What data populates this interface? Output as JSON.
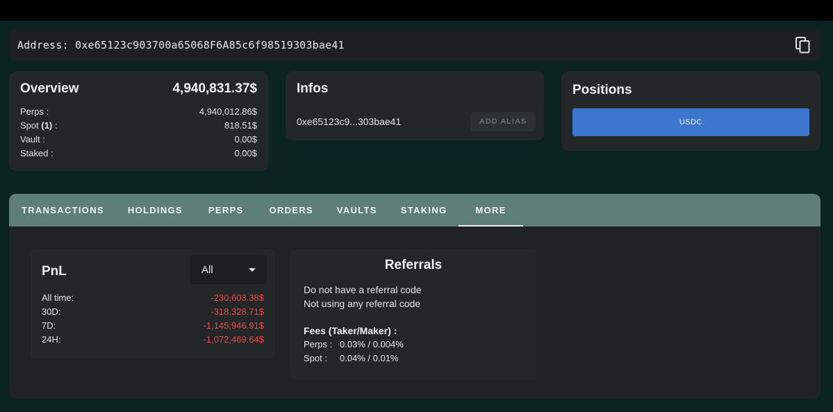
{
  "address": {
    "label": "Address:",
    "value": "0xe65123c903700a65068F6A85c6f98519303bae41",
    "copy_icon": "copy-icon"
  },
  "overview": {
    "title": "Overview",
    "total": "4,940,831.37$",
    "rows": [
      {
        "label": "Perps :",
        "value": "4,940,012.86$"
      },
      {
        "label_pre": "Spot ",
        "label_count": "(1)",
        "label_post": " :",
        "value": "818.51$"
      },
      {
        "label": "Vault :",
        "value": "0.00$"
      },
      {
        "label": "Staked :",
        "value": "0.00$"
      }
    ]
  },
  "infos": {
    "title": "Infos",
    "short_address": "0xe65123c9...303bae41",
    "alias_button": "ADD ALIAS"
  },
  "positions": {
    "title": "Positions",
    "bar_label": "USDC",
    "bar_color": "#3c76cf"
  },
  "tabs": [
    {
      "label": "TRANSACTIONS",
      "active": false
    },
    {
      "label": "HOLDINGS",
      "active": false
    },
    {
      "label": "PERPS",
      "active": false
    },
    {
      "label": "ORDERS",
      "active": false
    },
    {
      "label": "VAULTS",
      "active": false
    },
    {
      "label": "STAKING",
      "active": false
    },
    {
      "label": "MORE",
      "active": true
    }
  ],
  "pnl": {
    "title": "PnL",
    "period_select": "All",
    "rows": [
      {
        "label": "All time:",
        "value": "-230,603.38$"
      },
      {
        "label": "30D:",
        "value": "-318,328.71$"
      },
      {
        "label": "7D:",
        "value": "-1,145,946.91$"
      },
      {
        "label": "24H:",
        "value": "-1,072,469.64$"
      }
    ],
    "negative_color": "#ef4646"
  },
  "referrals": {
    "title": "Referrals",
    "lines": [
      "Do not have a referral code",
      "Not using any referral code"
    ],
    "fees_title": "Fees (Taker/Maker) :",
    "fees": [
      {
        "label": "Perps :",
        "value": "0.03% / 0.004%"
      },
      {
        "label": "Spot :",
        "value": "0.04% / 0.01%"
      }
    ]
  }
}
